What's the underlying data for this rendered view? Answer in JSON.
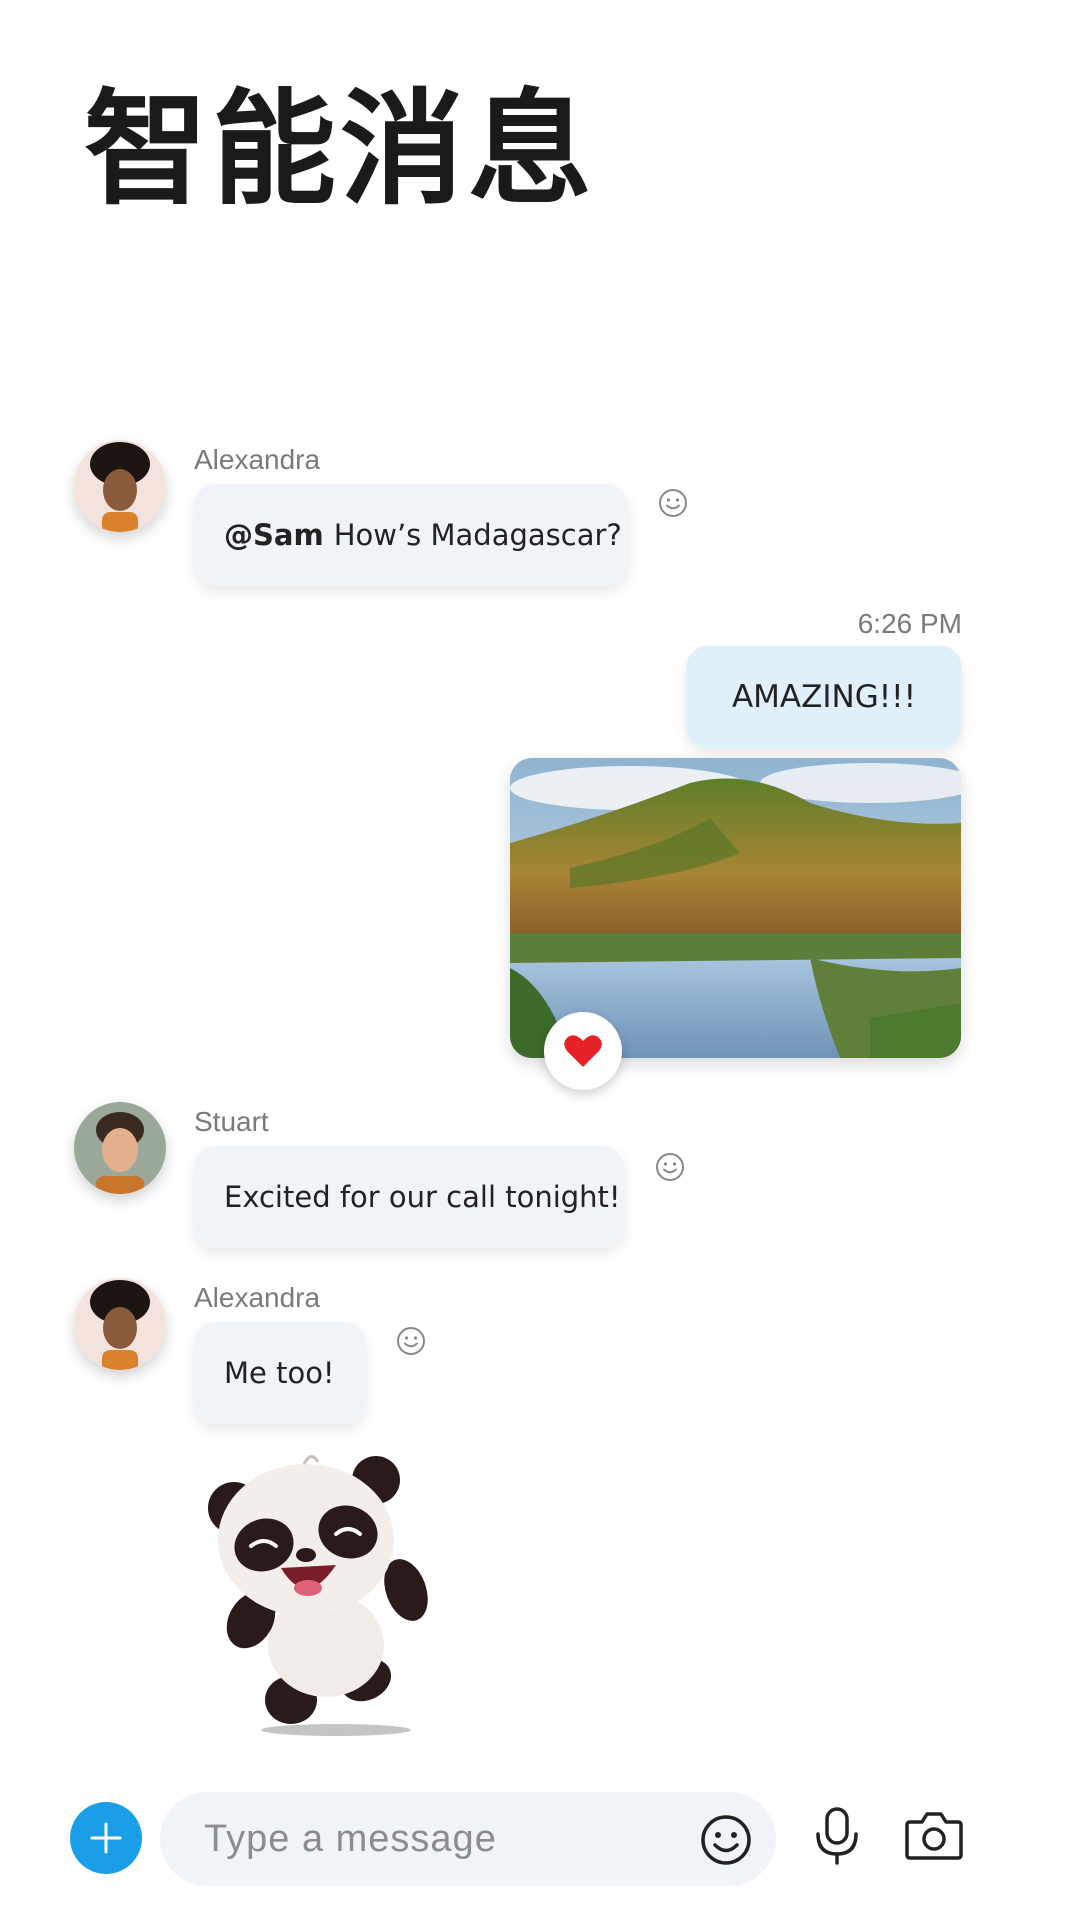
{
  "headline": "智能消息",
  "messages": [
    {
      "sender": "Alexandra",
      "mention": "@Sam",
      "text": "How’s Madagascar?"
    },
    {
      "timestamp": "6:26 PM",
      "text": "AMAZING!!!"
    },
    {
      "sender": "Stuart",
      "text": "Excited for our call tonight!"
    },
    {
      "sender": "Alexandra",
      "text": "Me too!"
    }
  ],
  "composer": {
    "placeholder": "Type a message"
  },
  "icons": {
    "react": "smiley-icon",
    "reaction": "heart-icon",
    "add": "plus-icon",
    "emoji": "emoji-icon",
    "mic": "microphone-icon",
    "camera": "camera-icon"
  },
  "colors": {
    "accent": "#1a9ee8",
    "incoming_bubble": "#f0f3f7",
    "outgoing_bubble": "#dff0fb",
    "heart": "#e52228"
  }
}
